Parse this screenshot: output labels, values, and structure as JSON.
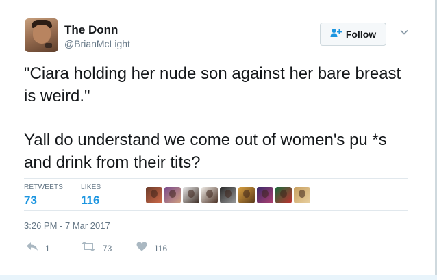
{
  "author": {
    "display_name": "The Donn",
    "handle": "@BrianMcLight"
  },
  "follow_button": {
    "label": "Follow"
  },
  "tweet": {
    "line1": "\"Ciara holding her nude son against her bare breast is weird.\"",
    "line2": "Yall do understand we come out of women's pu   *s and drink from their tits?"
  },
  "stats": {
    "retweets_label": "RETWEETS",
    "retweets_count": "73",
    "likes_label": "LIKES",
    "likes_count": "116"
  },
  "liker_avatars": [
    {
      "colors": [
        "#6b3b2a",
        "#d06b4a"
      ]
    },
    {
      "colors": [
        "#7a4a8c",
        "#d0a080"
      ]
    },
    {
      "colors": [
        "#e9e9e9",
        "#3a2a22"
      ]
    },
    {
      "colors": [
        "#f0ece6",
        "#4a3024"
      ]
    },
    {
      "colors": [
        "#2a2a2a",
        "#9a9a9a"
      ]
    },
    {
      "colors": [
        "#d8a040",
        "#5a3a1a"
      ]
    },
    {
      "colors": [
        "#3a2a6a",
        "#b04070"
      ]
    },
    {
      "colors": [
        "#1a6a3a",
        "#c03030"
      ]
    },
    {
      "colors": [
        "#c8a060",
        "#e8d0a0"
      ]
    }
  ],
  "timestamp": "3:26 PM - 7 Mar 2017",
  "actions": {
    "reply_count": "1",
    "retweet_count": "73",
    "like_count": "116"
  },
  "icons": {
    "follow": "add-person-icon",
    "caret": "chevron-down-icon",
    "reply": "reply-icon",
    "retweet": "retweet-icon",
    "like": "heart-icon"
  },
  "colors": {
    "link_blue": "#1b95e0",
    "muted_gray": "#657786",
    "text": "#14171a"
  }
}
